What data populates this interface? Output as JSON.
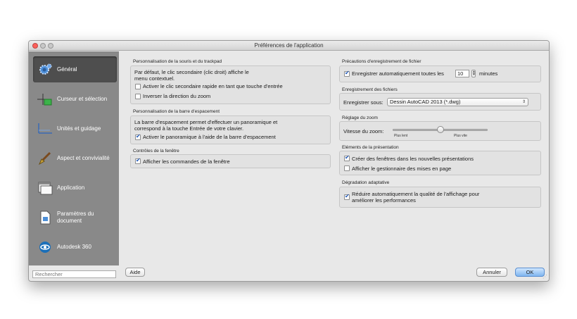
{
  "window": {
    "title": "Préférences de l'application"
  },
  "sidebar": {
    "items": [
      {
        "label": "Général",
        "icon": "gear-icon",
        "active": true
      },
      {
        "label": "Curseur et sélection",
        "icon": "cursor-icon"
      },
      {
        "label": "Unités et guidage",
        "icon": "ruler-icon"
      },
      {
        "label": "Aspect et convivialité",
        "icon": "paintbrush-icon"
      },
      {
        "label": "Application",
        "icon": "application-icon"
      },
      {
        "label": "Paramètres du document",
        "icon": "document-icon"
      },
      {
        "label": "Autodesk 360",
        "icon": "autodesk-360-icon"
      }
    ],
    "search_placeholder": "Rechercher"
  },
  "left": {
    "mouse": {
      "title": "Personnalisation de la souris et du trackpad",
      "desc_line1": "Par défaut, le clic secondaire (clic droit) affiche le",
      "desc_line2": "menu contextuel.",
      "opt1": {
        "label": "Activer le clic secondaire rapide en tant que touche d'entrée",
        "checked": false
      },
      "opt2": {
        "label": "Inverser la direction du zoom",
        "checked": false
      }
    },
    "spacebar": {
      "title": "Personnalisation de la barre d'espacement",
      "desc_line1": "La barre d'espacement permet d'effectuer un panoramique et",
      "desc_line2": "correspond à la touche Entrée de votre clavier.",
      "opt1": {
        "label": "Activer le panoramique à l'aide de la barre d'espacement",
        "checked": true
      }
    },
    "window_controls": {
      "title": "Contrôles de la fenêtre",
      "opt1": {
        "label": "Afficher les commandes de la fenêtre",
        "checked": true
      }
    }
  },
  "right": {
    "save_precautions": {
      "title": "Précautions d'enregistrement de fichier",
      "autosave_label": "Enregistrer automatiquement toutes les",
      "autosave_checked": true,
      "autosave_value": "10",
      "autosave_unit": "minutes"
    },
    "file_save": {
      "title": "Enregistrement des fichiers",
      "save_as_label": "Enregistrer sous:",
      "save_as_value": "Dessin AutoCAD 2013 (*.dwg)"
    },
    "zoom": {
      "title": "Réglage du zoom",
      "speed_label": "Vitesse du zoom:",
      "slow_label": "Plus lent",
      "fast_label": "Plus vite",
      "speed_fraction": 0.5
    },
    "layouts": {
      "title": "Eléments de la présentation",
      "opt1": {
        "label": "Créer des fenêtres dans les nouvelles présentations",
        "checked": true
      },
      "opt2": {
        "label": "Afficher le gestionnaire des mises en page",
        "checked": false
      }
    },
    "adaptive": {
      "title": "Dégradation adaptative",
      "opt1_line1": "Réduire automatiquement la qualité de l'affichage pour",
      "opt1_line2": "améliorer les performances",
      "checked": true
    }
  },
  "footer": {
    "help": "Aide",
    "cancel": "Annuler",
    "ok": "OK"
  },
  "colors": {
    "sidebar": "#898989",
    "active_item": "#4e4e4e",
    "accent": "#1d56b8"
  }
}
